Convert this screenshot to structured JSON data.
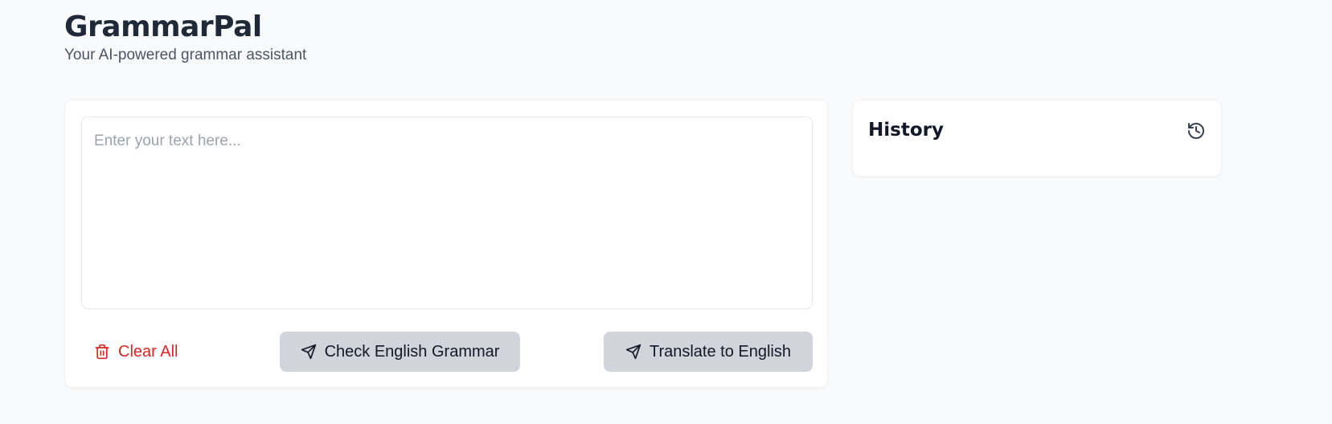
{
  "header": {
    "title": "GrammarPal",
    "subtitle": "Your AI-powered grammar assistant"
  },
  "editor": {
    "placeholder": "Enter your text here...",
    "value": ""
  },
  "actions": {
    "clear_label": "Clear All",
    "check_label": "Check English Grammar",
    "translate_label": "Translate to English"
  },
  "history": {
    "title": "History"
  },
  "icons": {
    "clear": "trash-icon",
    "check": "send-icon",
    "translate": "send-icon",
    "history": "history-icon"
  },
  "colors": {
    "background": "#f9fafb",
    "danger": "#dc2626",
    "button_bg": "#d1d5db",
    "text": "#1f2937"
  }
}
